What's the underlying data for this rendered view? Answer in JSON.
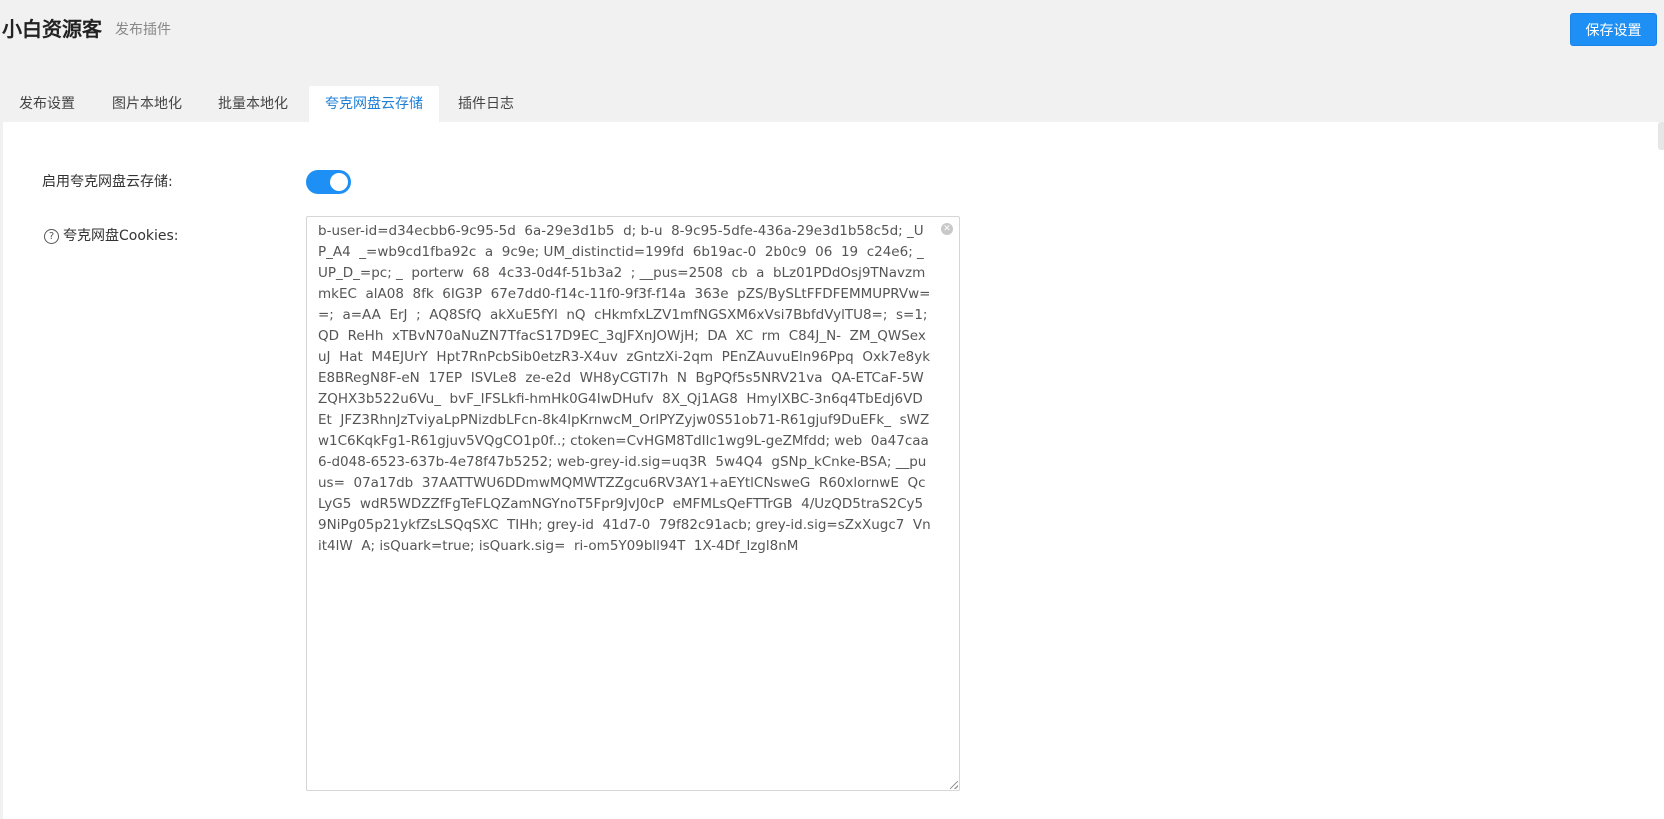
{
  "header": {
    "brand": "小白资源客",
    "subtitle": "发布插件",
    "save_label": "保存设置"
  },
  "tabs": [
    {
      "label": "发布设置",
      "active": false
    },
    {
      "label": "图片本地化",
      "active": false
    },
    {
      "label": "批量本地化",
      "active": false
    },
    {
      "label": "夸克网盘云存储",
      "active": true
    },
    {
      "label": "插件日志",
      "active": false
    }
  ],
  "form": {
    "enable_label": "启用夸克网盘云存储:",
    "enable_value": true,
    "cookies_label": "夸克网盘Cookies:",
    "cookies_value": "b-user-id=d34ecbb6-9c95-5d  6a-29e3d1b5  d; b-u  8-9c95-5dfe-436a-29e3d1b58c5d; _UP_A4  _=wb9cd1fba92c  a  9c9e; UM_distinctid=199fd  6b19ac-0  2b0c9  06  19  c24e6; _UP_D_=pc; _  porterw  68  4c33-0d4f-51b3a2  ; __pus=2508  cb  a  bLz01PDdOsj9TNavzmmkEC  alA08  8fk  6IG3P  67e7dd0-f14c-11f0-9f3f-f14a  363e  pZS/BySLtFFDFEMMUPRVw==;  a=AA  ErJ  ;  AQ8SfQ  akXuE5fYl  nQ  cHkmfxLZV1mfNGSXM6xVsi7BbfdVylTU8=;  s=1;  QD  ReHh  xTBvN70aNuZN7TfacS17D9EC_3qJFXnJOWjH;  DA  XC  rm  C84J_N-  ZM_QWSexuJ  Hat  M4EJUrY  Hpt7RnPcbSib0etzR3-X4uv  zGntzXi-2qm  PEnZAuvuEln96Ppq  Oxk7e8ykE8BRegN8F-eN  17EP  ISVLe8  ze-e2d  WH8yCGTl7h  N  BgPQf5s5NRV21va  QA-ETCaF-5WZQHX3b522u6Vu_  bvF_IFSLkfi-hmHk0G4IwDHufv  8X_Qj1AG8  HmylXBC-3n6q4TbEdj6VDEt  JFZ3RhnJzTviyaLpPNizdbLFcn-8k4lpKrnwcM_OrlPYZyjw0S51ob71-R61gjuf9DuEFk_  sWZw1C6KqkFg1-R61gjuv5VQgCO1p0f..; ctoken=CvHGM8TdIlc1wg9L-geZMfdd; web  0a47caa6-d048-6523-637b-4e78f47b5252; web-grey-id.sig=uq3R  5w4Q4  gSNp_kCnke-BSA; __puus=  07a17db  37AATTWU6DDmwMQMWTZZgcu6RV3AY1+aEYtlCNsweG  R60xlornwE  QcLyG5  wdR5WDZZfFgTeFLQZamNGYnoT5Fpr9JvJ0cP  eMFMLsQeFTTrGB  4/UzQD5traS2Cy59NiPg05p21ykfZsLSQqSXC  TIHh; grey-id  41d7-0  79f82c91acb; grey-id.sig=sZxXugc7  Vnit4lW  A; isQuark=true; isQuark.sig=  ri-om5Y09bll94T  1X-4Df_lzgl8nM"
  },
  "colors": {
    "accent": "#1e90f5",
    "active_tab_text": "#1e7fd8",
    "page_bg": "#f1f1f1",
    "panel_bg": "#ffffff"
  },
  "icons": {
    "help": "question-circle-icon",
    "clear": "clear-icon"
  }
}
